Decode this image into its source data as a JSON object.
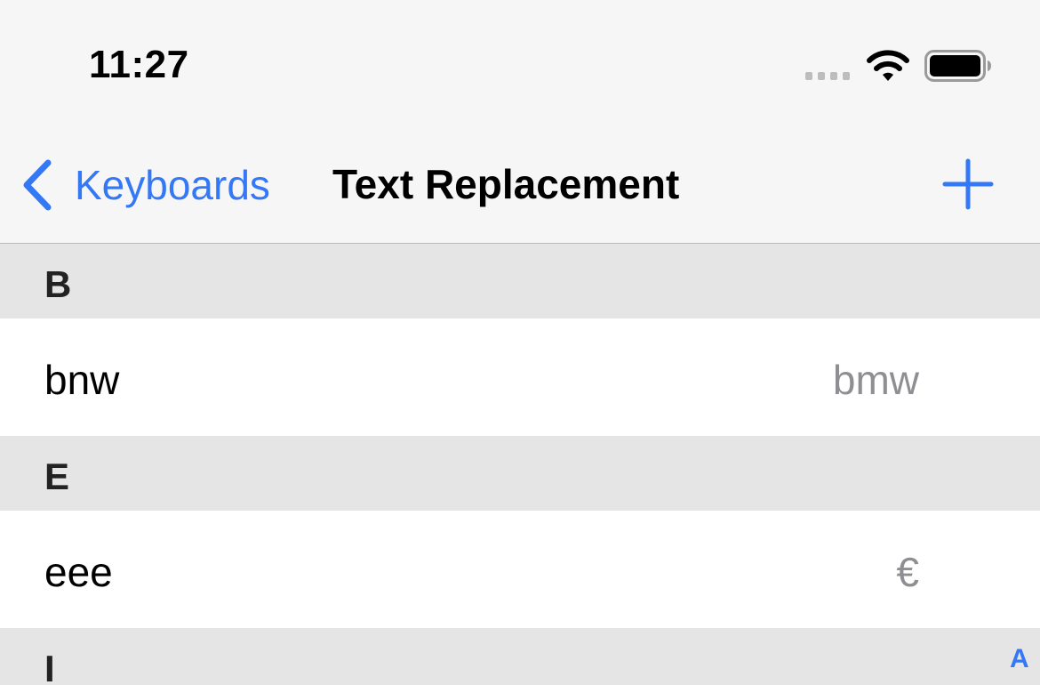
{
  "status_bar": {
    "time": "11:27",
    "icons": [
      "signal-dots-icon",
      "wifi-icon",
      "battery-icon"
    ]
  },
  "nav": {
    "back_label": "Keyboards",
    "title": "Text Replacement",
    "add_icon": "plus-icon",
    "accent_color": "#3478f6"
  },
  "sections": [
    {
      "letter": "B",
      "rows": [
        {
          "shortcut": "bnw",
          "phrase": "bmw"
        }
      ]
    },
    {
      "letter": "E",
      "rows": [
        {
          "shortcut": "eee",
          "phrase": "€"
        }
      ]
    },
    {
      "letter": "I",
      "rows": []
    }
  ],
  "index": {
    "letters": [
      "A"
    ]
  }
}
